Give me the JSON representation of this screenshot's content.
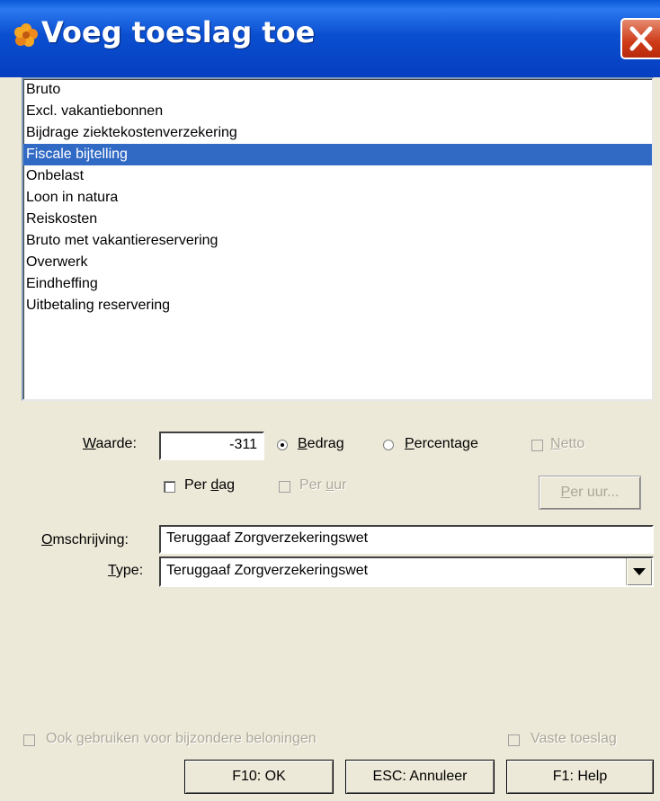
{
  "window": {
    "title": "Voeg toeslag toe"
  },
  "list": {
    "items": [
      "Bruto",
      "Excl. vakantiebonnen",
      "Bijdrage ziektekostenverzekering",
      "Fiscale bijtelling",
      "Onbelast",
      "Loon in natura",
      "Reiskosten",
      "Bruto met vakantiereservering",
      "Overwerk",
      "Eindheffing",
      "Uitbetaling reservering"
    ],
    "selected_index": 3
  },
  "form": {
    "waarde_label_u": "W",
    "waarde_label_rest": "aarde:",
    "waarde_value": "-311",
    "bedrag_u": "B",
    "bedrag_rest": "edrag",
    "percentage_u": "P",
    "percentage_rest": "ercentage",
    "netto_u": "N",
    "netto_rest": "etto",
    "per_dag_pre": "Per ",
    "per_dag_u": "d",
    "per_dag_post": "ag",
    "per_uur_pre": "Per ",
    "per_uur_u": "u",
    "per_uur_post": "ur",
    "per_uur_btn_u": "P",
    "per_uur_btn_rest": "er uur...",
    "omschrijving_u": "O",
    "omschrijving_rest": "mschrijving:",
    "omschrijving_value": "Teruggaaf Zorgverzekeringswet",
    "type_u": "T",
    "type_rest": "ype:",
    "type_value": "Teruggaaf Zorgverzekeringswet"
  },
  "footer": {
    "ook_pre": "Ook ",
    "ook_u": "g",
    "ook_post": "ebruiken voor bijzondere beloningen",
    "vaste_toeslag": "Vaste toeslag",
    "ok_button": "F10: OK",
    "cancel_button": "ESC: Annuleer",
    "help_button": "F1: Help"
  }
}
